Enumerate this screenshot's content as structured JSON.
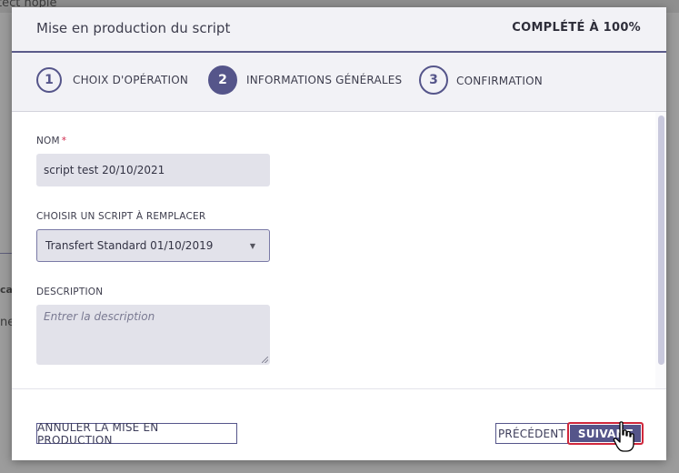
{
  "modal": {
    "title": "Mise en production du script",
    "progress": "COMPLÉTÉ À 100%"
  },
  "steps": [
    {
      "number": "1",
      "label": "CHOIX D'OPÉRATION",
      "active": false
    },
    {
      "number": "2",
      "label": "INFORMATIONS GÉNÉRALES",
      "active": true
    },
    {
      "number": "3",
      "label": "CONFIRMATION",
      "active": false
    }
  ],
  "form": {
    "name": {
      "label": "NOM",
      "required_mark": "*",
      "value": "script test 20/10/2021"
    },
    "replace_script": {
      "label": "CHOISIR UN SCRIPT À REMPLACER",
      "selected": "Transfert Standard 01/10/2019"
    },
    "description": {
      "label": "DESCRIPTION",
      "placeholder": "Entrer la description"
    }
  },
  "footer": {
    "cancel_label": "ANNULER LA MISE EN PRODUCTION",
    "previous_label": "PRÉCÉDENT",
    "next_label": "SUIVANT"
  },
  "background": {
    "left_text_1": "cal",
    "left_text_2": "ne",
    "top_text": "tect   nopie"
  },
  "colors": {
    "accent": "#55558a",
    "focus_outline": "#d0283c",
    "required": "#d0284b"
  }
}
